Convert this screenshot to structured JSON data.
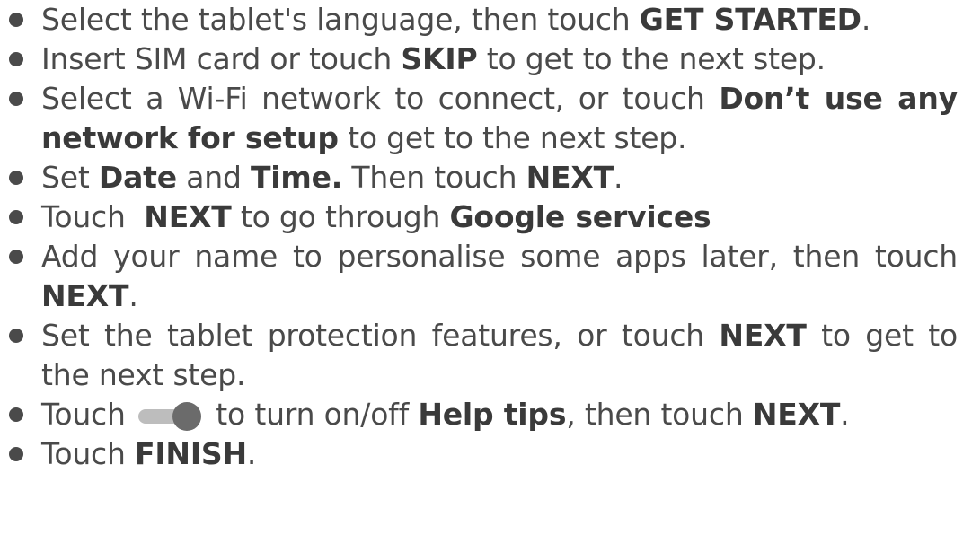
{
  "steps": [
    {
      "pre": "Select the tablet's language, then touch ",
      "b1": "GET STARTED",
      "post": "."
    },
    {
      "pre": "Insert SIM card or touch ",
      "b1": "SKIP",
      "post": " to get to the next step."
    },
    {
      "pre": "Select a Wi-Fi network to connect, or touch ",
      "b1": "Don’t use any network for setup",
      "post": " to get to the next step."
    },
    {
      "pre": "Set ",
      "b1": "Date",
      "mid1": " and ",
      "b2": "Time.",
      "mid2": " Then touch ",
      "b3": "NEXT",
      "post": "."
    },
    {
      "pre": "Touch  ",
      "b1": "NEXT",
      "mid1": " to go through ",
      "b2": "Google services"
    },
    {
      "pre": "Add your name to personalise some apps later, then touch ",
      "b1": "NEXT",
      "post": "."
    },
    {
      "pre": "Set the tablet protection features, or touch ",
      "b1": "NEXT",
      "post": " to get to the next step."
    },
    {
      "pre": "Touch ",
      "icon": "toggle-switch-icon",
      "mid1": " to turn on/off ",
      "b1": "Help tips",
      "mid2": ", then touch ",
      "b2": "NEXT",
      "post": "."
    },
    {
      "pre": "Touch ",
      "b1": "FINISH",
      "post": "."
    }
  ],
  "colors": {
    "text": "#4a4a4a",
    "toggle_track": "#bdbdbd",
    "toggle_knob": "#6b6b6b"
  }
}
